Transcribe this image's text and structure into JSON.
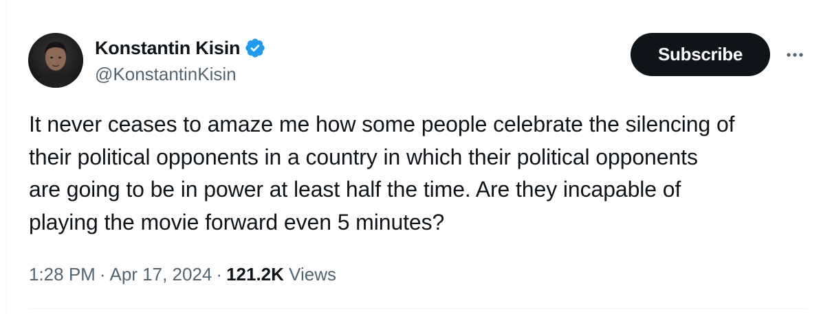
{
  "author": {
    "display_name": "Konstantin Kisin",
    "handle": "@KonstantinKisin",
    "verified": true,
    "avatar_icon": "profile-photo"
  },
  "actions": {
    "subscribe_label": "Subscribe",
    "more_icon": "ellipsis-icon"
  },
  "tweet": {
    "text_lines": [
      "It never ceases to amaze me how some people celebrate the silencing of",
      "their political opponents in a country in which their political opponents",
      "are going to be in power at least half the time. Are they incapable of",
      "playing the movie forward even 5 minutes?"
    ]
  },
  "meta": {
    "time": "1:28 PM",
    "separator": "·",
    "date": "Apr 17, 2024",
    "view_count": "121.2K",
    "views_label": "Views"
  },
  "colors": {
    "text": "#0f1419",
    "secondary": "#536471",
    "verified_blue": "#1d9bf0",
    "button_bg": "#0f1419"
  }
}
